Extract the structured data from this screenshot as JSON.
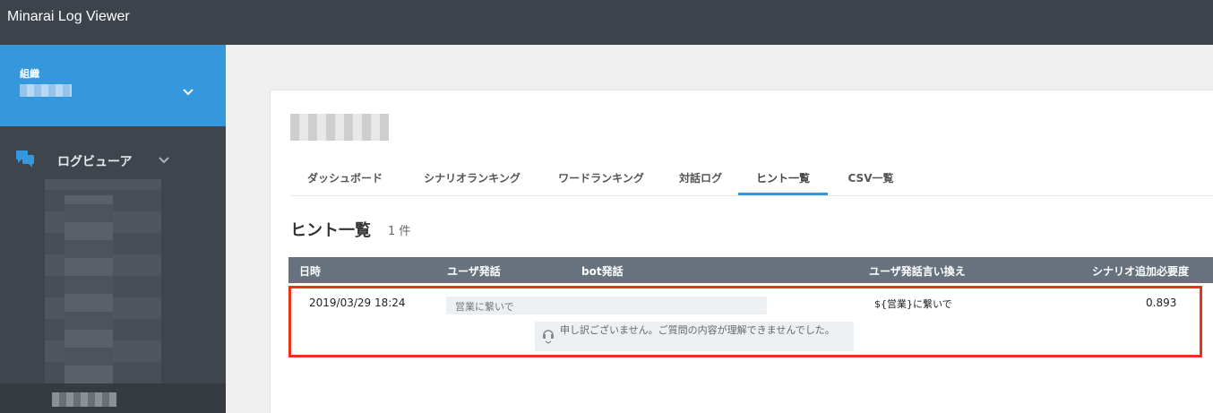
{
  "app": {
    "title": "Minarai Log Viewer"
  },
  "sidebar": {
    "org": {
      "label": "組織",
      "value": ""
    },
    "nav": [
      {
        "label": "ログビューア",
        "icon": "chat-bubbles-icon"
      }
    ]
  },
  "tabs": [
    {
      "label": "ダッシュボード"
    },
    {
      "label": "シナリオランキング"
    },
    {
      "label": "ワードランキング"
    },
    {
      "label": "対話ログ"
    },
    {
      "label": "ヒント一覧",
      "active": true
    },
    {
      "label": "CSV一覧"
    }
  ],
  "main": {
    "title": "ヒント一覧",
    "count": "1 件"
  },
  "table": {
    "headers": [
      "日時",
      "ユーザ発話",
      "bot発話",
      "ユーザ発話言い換え",
      "シナリオ追加必要度"
    ],
    "rows": [
      {
        "date": "2019/03/29 18:24",
        "user": "営業に繋いで",
        "bot": "申し訳ございません。ご質問の内容が理解できませんでした。",
        "rephrase": "${営業}に繋いで",
        "score": "0.893"
      }
    ]
  },
  "colors": {
    "accent": "#3598dc",
    "topbar": "#3d434b",
    "sidebar": "#3f454d",
    "highlight": "#e8321c",
    "table_header": "#67727e"
  }
}
